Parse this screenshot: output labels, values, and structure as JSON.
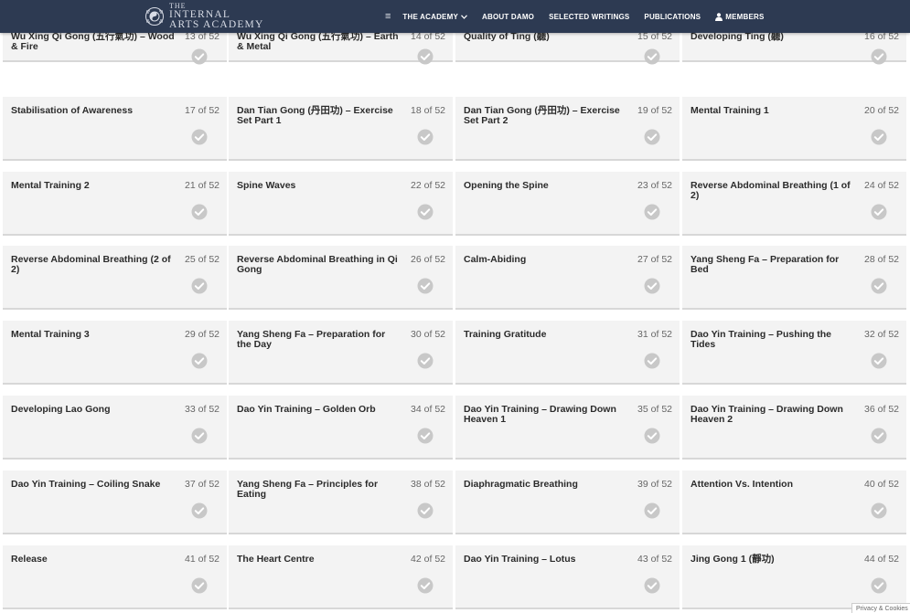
{
  "nav": {
    "logo": {
      "the": "THE",
      "line1": "INTERNAL",
      "line2": "ARTS ACADEMY"
    },
    "hamburger": "≡",
    "items": [
      {
        "label": "THE ACADEMY",
        "dropdown": true
      },
      {
        "label": "ABOUT DAMO"
      },
      {
        "label": "SELECTED WRITINGS"
      },
      {
        "label": "PUBLICATIONS"
      },
      {
        "label": "MEMBERS",
        "icon": "user-icon"
      }
    ]
  },
  "lessons": [
    {
      "title": "Wu Xing Qi Gong (五行氣功) – Wood & Fire",
      "count": "13 of 52"
    },
    {
      "title": "Wu Xing Qi Gong (五行氣功) – Earth & Metal",
      "count": "14 of 52"
    },
    {
      "title": "Quality of Ting (聽)",
      "count": "15 of 52"
    },
    {
      "title": "Developing Ting (聽)",
      "count": "16 of 52"
    },
    {
      "title": "Stabilisation of Awareness",
      "count": "17 of 52"
    },
    {
      "title": "Dan Tian Gong (丹田功) – Exercise Set Part 1",
      "count": "18 of 52"
    },
    {
      "title": "Dan Tian Gong (丹田功) – Exercise Set Part 2",
      "count": "19 of 52"
    },
    {
      "title": "Mental Training 1",
      "count": "20 of 52"
    },
    {
      "title": "Mental Training 2",
      "count": "21 of 52"
    },
    {
      "title": "Spine Waves",
      "count": "22 of 52"
    },
    {
      "title": "Opening the Spine",
      "count": "23 of 52"
    },
    {
      "title": "Reverse Abdominal Breathing (1 of 2)",
      "count": "24 of 52"
    },
    {
      "title": "Reverse Abdominal Breathing (2 of 2)",
      "count": "25 of 52"
    },
    {
      "title": "Reverse Abdominal Breathing in Qi Gong",
      "count": "26 of 52"
    },
    {
      "title": "Calm-Abiding",
      "count": "27 of 52"
    },
    {
      "title": "Yang Sheng Fa – Preparation for Bed",
      "count": "28 of 52"
    },
    {
      "title": "Mental Training 3",
      "count": "29 of 52"
    },
    {
      "title": "Yang Sheng Fa – Preparation for the Day",
      "count": "30 of 52"
    },
    {
      "title": "Training Gratitude",
      "count": "31 of 52"
    },
    {
      "title": "Dao Yin Training – Pushing the Tides",
      "count": "32 of 52"
    },
    {
      "title": "Developing Lao Gong",
      "count": "33 of 52"
    },
    {
      "title": "Dao Yin Training – Golden Orb",
      "count": "34 of 52"
    },
    {
      "title": "Dao Yin Training – Drawing Down Heaven 1",
      "count": "35 of 52"
    },
    {
      "title": "Dao Yin Training – Drawing Down Heaven 2",
      "count": "36 of 52"
    },
    {
      "title": "Dao Yin Training – Coiling Snake",
      "count": "37 of 52"
    },
    {
      "title": "Yang Sheng Fa – Principles for Eating",
      "count": "38 of 52"
    },
    {
      "title": "Diaphragmatic Breathing",
      "count": "39 of 52"
    },
    {
      "title": "Attention Vs. Intention",
      "count": "40 of 52"
    },
    {
      "title": "Release",
      "count": "41 of 52"
    },
    {
      "title": "The Heart Centre",
      "count": "42 of 52"
    },
    {
      "title": "Dao Yin Training – Lotus",
      "count": "43 of 52"
    },
    {
      "title": "Jing Gong 1 (靜功)",
      "count": "44 of 52"
    }
  ],
  "privacy": {
    "label": "Privacy & Cookies"
  },
  "colors": {
    "navbar": "#2d3a52",
    "card_bg": "#f3f3f3",
    "check": "#c8c8c8"
  }
}
